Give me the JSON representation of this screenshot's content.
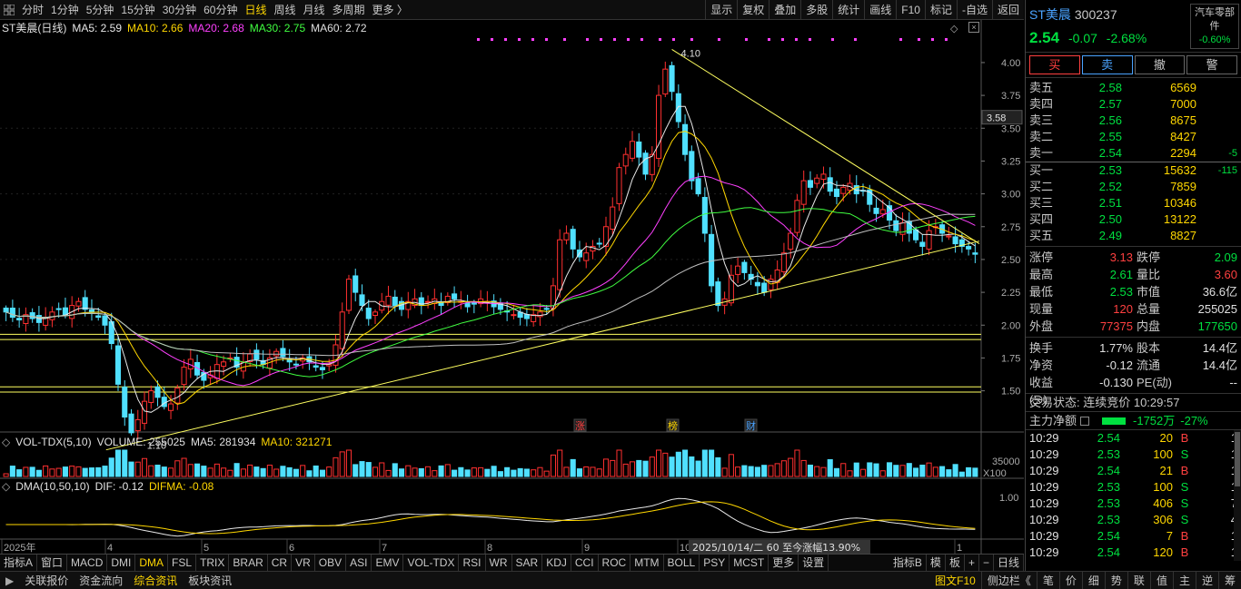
{
  "topbar": {
    "tabs": [
      "分时",
      "1分钟",
      "5分钟",
      "15分钟",
      "30分钟",
      "60分钟",
      "日线",
      "周线",
      "月线",
      "多周期",
      "更多 〉"
    ],
    "active_tab": "日线",
    "tools": [
      "显示",
      "复权",
      "叠加",
      "多股",
      "统计",
      "画线",
      "F10",
      "标记",
      "-自选",
      "返回"
    ]
  },
  "legend_main": {
    "name": "ST美晨(日线)",
    "ma5": "MA5: 2.59",
    "ma10": "MA10: 2.66",
    "ma20": "MA20: 2.68",
    "ma30": "MA30: 2.75",
    "ma60": "MA60: 2.72"
  },
  "legend_vol": {
    "name": "VOL-TDX(5,10)",
    "volume": "VOLUME: 255025",
    "ma5": "MA5: 281934",
    "ma10": "MA10: 321271"
  },
  "legend_dma": {
    "name": "DMA(10,50,10)",
    "dif": "DIF: -0.12",
    "difma": "DIFMA: -0.08"
  },
  "colors": {
    "up": "#ff3030",
    "down": "#50e0ff",
    "ma5": "#e8e8e8",
    "ma10": "#ffd700",
    "ma20": "#ff40ff",
    "ma30": "#40ff40",
    "ma60": "#c0c0c0",
    "trendline": "#ffff60"
  },
  "chart_data": [
    {
      "type": "candlestick",
      "title": "ST美晨(日线)",
      "y_ticks": [
        1.5,
        1.75,
        2.0,
        2.25,
        2.5,
        2.75,
        3.0,
        3.25,
        3.5,
        3.75,
        4.0
      ],
      "ylim": [
        1.2,
        4.2
      ],
      "x_month_labels": [
        "2025年",
        "4",
        "5",
        "6",
        "7",
        "8",
        "9",
        "10",
        "1"
      ],
      "current_price_label": "3.58",
      "annotations": {
        "high": "4.10",
        "low": "1.10",
        "event_up": "涨",
        "event_list": "榜",
        "event_fin": "财"
      },
      "horizontal_lines": [
        1.93,
        1.89,
        1.53,
        1.49
      ],
      "closes": [
        2.1,
        2.06,
        2.04,
        2.08,
        2.05,
        2.02,
        2.06,
        2.1,
        2.12,
        2.08,
        2.15,
        2.18,
        2.12,
        2.1,
        2.06,
        2.0,
        1.86,
        1.55,
        1.3,
        1.18,
        1.28,
        1.42,
        1.5,
        1.45,
        1.38,
        1.4,
        1.52,
        1.68,
        1.74,
        1.62,
        1.58,
        1.62,
        1.7,
        1.72,
        1.75,
        1.68,
        1.72,
        1.78,
        1.74,
        1.7,
        1.75,
        1.8,
        1.76,
        1.72,
        1.7,
        1.75,
        1.72,
        1.68,
        1.66,
        1.7,
        1.85,
        2.1,
        2.35,
        2.25,
        2.15,
        2.05,
        2.1,
        2.18,
        2.22,
        2.15,
        2.12,
        2.18,
        2.2,
        2.15,
        2.18,
        2.2,
        2.15,
        2.22,
        2.2,
        2.18,
        2.14,
        2.16,
        2.2,
        2.18,
        2.14,
        2.12,
        2.1,
        2.08,
        2.06,
        2.05,
        2.08,
        2.1,
        2.12,
        2.3,
        2.65,
        2.7,
        2.58,
        2.52,
        2.55,
        2.6,
        2.62,
        2.75,
        2.9,
        3.2,
        3.3,
        3.4,
        3.28,
        3.15,
        3.3,
        3.75,
        3.95,
        3.78,
        3.55,
        3.3,
        3.1,
        3.0,
        2.7,
        2.3,
        2.15,
        2.2,
        2.38,
        2.45,
        2.4,
        2.35,
        2.3,
        2.25,
        2.35,
        2.42,
        2.55,
        2.7,
        2.95,
        3.1,
        3.05,
        3.12,
        3.15,
        3.02,
        2.98,
        3.05,
        3.08,
        3.0,
        3.02,
        2.92,
        2.85,
        2.88,
        2.8,
        2.72,
        2.78,
        2.7,
        2.65,
        2.6,
        2.72,
        2.75,
        2.7,
        2.68,
        2.62,
        2.6,
        2.58,
        2.54
      ],
      "y_current": 2.54
    },
    {
      "type": "bar",
      "title": "VOL-TDX(5,10)",
      "y_tick_label": "35000",
      "unit_label": "X100"
    },
    {
      "type": "line",
      "title": "DMA(10,50,10)",
      "y_tick_label": "1.00",
      "status_text": "2025/10/14/二 60 至今涨幅13.90%"
    }
  ],
  "indicator_tabs": [
    "指标A",
    "窗口",
    "MACD",
    "DMI",
    "DMA",
    "FSL",
    "TRIX",
    "BRAR",
    "CR",
    "VR",
    "OBV",
    "ASI",
    "EMV",
    "VOL-TDX",
    "RSI",
    "WR",
    "SAR",
    "KDJ",
    "CCI",
    "ROC",
    "MTM",
    "BOLL",
    "PSY",
    "MCST",
    "更多",
    "设置"
  ],
  "indicator_active": "DMA",
  "indicator_right": [
    "指标B",
    "模",
    "板",
    "+",
    "−",
    "日线"
  ],
  "statusbar": {
    "tabs": [
      "关联报价",
      "资金流向",
      "综合资讯",
      "板块资讯"
    ],
    "active": "综合资讯",
    "right": [
      "图文F10",
      "侧边栏《",
      "笔",
      "价",
      "细",
      "势",
      "联",
      "值",
      "主",
      "逆",
      "筹"
    ]
  },
  "quote": {
    "name": "ST美晨",
    "code": "300237",
    "price": "2.54",
    "change": "-0.07",
    "change_pct": "-2.68%",
    "sector_name": "汽车零部件",
    "sector_pct": "-0.60%",
    "buttons": [
      "买",
      "卖",
      "撤",
      "警"
    ],
    "asks": [
      {
        "label": "卖五",
        "price": "2.58",
        "vol": "6569",
        "diff": ""
      },
      {
        "label": "卖四",
        "price": "2.57",
        "vol": "7000",
        "diff": ""
      },
      {
        "label": "卖三",
        "price": "2.56",
        "vol": "8675",
        "diff": ""
      },
      {
        "label": "卖二",
        "price": "2.55",
        "vol": "8427",
        "diff": ""
      },
      {
        "label": "卖一",
        "price": "2.54",
        "vol": "2294",
        "diff": "-5"
      }
    ],
    "bids": [
      {
        "label": "买一",
        "price": "2.53",
        "vol": "15632",
        "diff": "-115"
      },
      {
        "label": "买二",
        "price": "2.52",
        "vol": "7859",
        "diff": ""
      },
      {
        "label": "买三",
        "price": "2.51",
        "vol": "10346",
        "diff": ""
      },
      {
        "label": "买四",
        "price": "2.50",
        "vol": "13122",
        "diff": ""
      },
      {
        "label": "买五",
        "price": "2.49",
        "vol": "8827",
        "diff": ""
      }
    ],
    "stats1": [
      {
        "k1": "涨停",
        "v1": "3.13",
        "c1": "red",
        "k2": "跌停",
        "v2": "2.09",
        "c2": "green"
      },
      {
        "k1": "最高",
        "v1": "2.61",
        "c1": "green",
        "k2": "量比",
        "v2": "3.60",
        "c2": "red"
      },
      {
        "k1": "最低",
        "v1": "2.53",
        "c1": "green",
        "k2": "市值",
        "v2": "36.6亿",
        "c2": "white"
      },
      {
        "k1": "现量",
        "v1": "120",
        "c1": "red",
        "k2": "总量",
        "v2": "255025",
        "c2": "white"
      },
      {
        "k1": "外盘",
        "v1": "77375",
        "c1": "red",
        "k2": "内盘",
        "v2": "177650",
        "c2": "green"
      }
    ],
    "stats2": [
      {
        "k1": "换手",
        "v1": "1.77%",
        "c1": "white",
        "k2": "股本",
        "v2": "14.4亿",
        "c2": "white"
      },
      {
        "k1": "净资",
        "v1": "-0.12",
        "c1": "white",
        "k2": "流通",
        "v2": "14.4亿",
        "c2": "white"
      },
      {
        "k1": "收益(∋)",
        "v1": "-0.130",
        "c1": "white",
        "k2": "PE(动)",
        "v2": "--",
        "c2": "white"
      }
    ],
    "trade_status": "交易状态: 连续竞价 10:29:57",
    "main_flow_label": "主力净额",
    "main_flow_value": "-1752万",
    "main_flow_pct": "-27%",
    "ticks": [
      {
        "t": "10:29",
        "p": "2.54",
        "v": "20",
        "s": "B",
        "n": "1"
      },
      {
        "t": "10:29",
        "p": "2.53",
        "v": "100",
        "s": "S",
        "n": "1"
      },
      {
        "t": "10:29",
        "p": "2.54",
        "v": "21",
        "s": "B",
        "n": "1"
      },
      {
        "t": "10:29",
        "p": "2.53",
        "v": "100",
        "s": "S",
        "n": "1"
      },
      {
        "t": "10:29",
        "p": "2.53",
        "v": "406",
        "s": "S",
        "n": "7"
      },
      {
        "t": "10:29",
        "p": "2.53",
        "v": "306",
        "s": "S",
        "n": "4"
      },
      {
        "t": "10:29",
        "p": "2.54",
        "v": "7",
        "s": "B",
        "n": "1"
      },
      {
        "t": "10:29",
        "p": "2.54",
        "v": "120",
        "s": "B",
        "n": "1"
      }
    ]
  }
}
